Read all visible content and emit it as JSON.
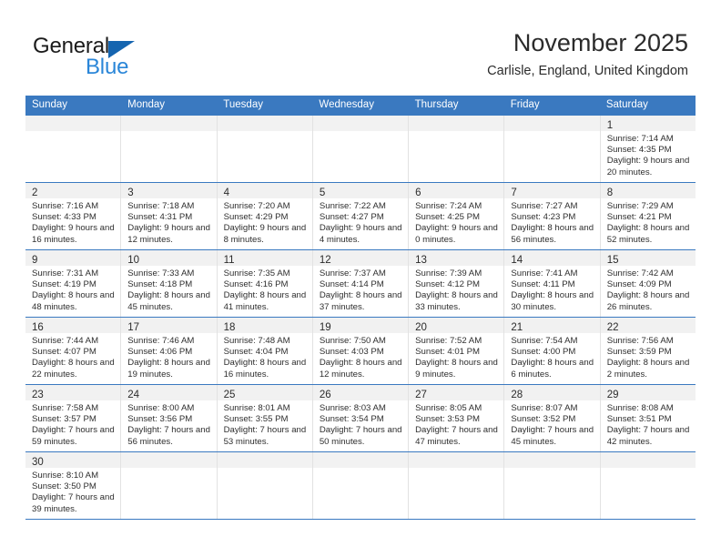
{
  "brand": {
    "line1": "General",
    "line2": "Blue",
    "triangle_icon": "brand-triangle-icon",
    "color_dark": "#1b1b1b",
    "color_blue": "#2a86d8"
  },
  "header": {
    "title": "November 2025",
    "subtitle": "Carlisle, England, United Kingdom"
  },
  "theme": {
    "header_blue": "#3a79c0",
    "daynum_band": "#f1f1f1",
    "grid_line": "#e2e2e2",
    "text": "#2b2b2b"
  },
  "weekdays": [
    "Sunday",
    "Monday",
    "Tuesday",
    "Wednesday",
    "Thursday",
    "Friday",
    "Saturday"
  ],
  "weeks": [
    [
      {
        "day": ""
      },
      {
        "day": ""
      },
      {
        "day": ""
      },
      {
        "day": ""
      },
      {
        "day": ""
      },
      {
        "day": ""
      },
      {
        "day": "1",
        "sunrise": "Sunrise: 7:14 AM",
        "sunset": "Sunset: 4:35 PM",
        "daylight": "Daylight: 9 hours and 20 minutes."
      }
    ],
    [
      {
        "day": "2",
        "sunrise": "Sunrise: 7:16 AM",
        "sunset": "Sunset: 4:33 PM",
        "daylight": "Daylight: 9 hours and 16 minutes."
      },
      {
        "day": "3",
        "sunrise": "Sunrise: 7:18 AM",
        "sunset": "Sunset: 4:31 PM",
        "daylight": "Daylight: 9 hours and 12 minutes."
      },
      {
        "day": "4",
        "sunrise": "Sunrise: 7:20 AM",
        "sunset": "Sunset: 4:29 PM",
        "daylight": "Daylight: 9 hours and 8 minutes."
      },
      {
        "day": "5",
        "sunrise": "Sunrise: 7:22 AM",
        "sunset": "Sunset: 4:27 PM",
        "daylight": "Daylight: 9 hours and 4 minutes."
      },
      {
        "day": "6",
        "sunrise": "Sunrise: 7:24 AM",
        "sunset": "Sunset: 4:25 PM",
        "daylight": "Daylight: 9 hours and 0 minutes."
      },
      {
        "day": "7",
        "sunrise": "Sunrise: 7:27 AM",
        "sunset": "Sunset: 4:23 PM",
        "daylight": "Daylight: 8 hours and 56 minutes."
      },
      {
        "day": "8",
        "sunrise": "Sunrise: 7:29 AM",
        "sunset": "Sunset: 4:21 PM",
        "daylight": "Daylight: 8 hours and 52 minutes."
      }
    ],
    [
      {
        "day": "9",
        "sunrise": "Sunrise: 7:31 AM",
        "sunset": "Sunset: 4:19 PM",
        "daylight": "Daylight: 8 hours and 48 minutes."
      },
      {
        "day": "10",
        "sunrise": "Sunrise: 7:33 AM",
        "sunset": "Sunset: 4:18 PM",
        "daylight": "Daylight: 8 hours and 45 minutes."
      },
      {
        "day": "11",
        "sunrise": "Sunrise: 7:35 AM",
        "sunset": "Sunset: 4:16 PM",
        "daylight": "Daylight: 8 hours and 41 minutes."
      },
      {
        "day": "12",
        "sunrise": "Sunrise: 7:37 AM",
        "sunset": "Sunset: 4:14 PM",
        "daylight": "Daylight: 8 hours and 37 minutes."
      },
      {
        "day": "13",
        "sunrise": "Sunrise: 7:39 AM",
        "sunset": "Sunset: 4:12 PM",
        "daylight": "Daylight: 8 hours and 33 minutes."
      },
      {
        "day": "14",
        "sunrise": "Sunrise: 7:41 AM",
        "sunset": "Sunset: 4:11 PM",
        "daylight": "Daylight: 8 hours and 30 minutes."
      },
      {
        "day": "15",
        "sunrise": "Sunrise: 7:42 AM",
        "sunset": "Sunset: 4:09 PM",
        "daylight": "Daylight: 8 hours and 26 minutes."
      }
    ],
    [
      {
        "day": "16",
        "sunrise": "Sunrise: 7:44 AM",
        "sunset": "Sunset: 4:07 PM",
        "daylight": "Daylight: 8 hours and 22 minutes."
      },
      {
        "day": "17",
        "sunrise": "Sunrise: 7:46 AM",
        "sunset": "Sunset: 4:06 PM",
        "daylight": "Daylight: 8 hours and 19 minutes."
      },
      {
        "day": "18",
        "sunrise": "Sunrise: 7:48 AM",
        "sunset": "Sunset: 4:04 PM",
        "daylight": "Daylight: 8 hours and 16 minutes."
      },
      {
        "day": "19",
        "sunrise": "Sunrise: 7:50 AM",
        "sunset": "Sunset: 4:03 PM",
        "daylight": "Daylight: 8 hours and 12 minutes."
      },
      {
        "day": "20",
        "sunrise": "Sunrise: 7:52 AM",
        "sunset": "Sunset: 4:01 PM",
        "daylight": "Daylight: 8 hours and 9 minutes."
      },
      {
        "day": "21",
        "sunrise": "Sunrise: 7:54 AM",
        "sunset": "Sunset: 4:00 PM",
        "daylight": "Daylight: 8 hours and 6 minutes."
      },
      {
        "day": "22",
        "sunrise": "Sunrise: 7:56 AM",
        "sunset": "Sunset: 3:59 PM",
        "daylight": "Daylight: 8 hours and 2 minutes."
      }
    ],
    [
      {
        "day": "23",
        "sunrise": "Sunrise: 7:58 AM",
        "sunset": "Sunset: 3:57 PM",
        "daylight": "Daylight: 7 hours and 59 minutes."
      },
      {
        "day": "24",
        "sunrise": "Sunrise: 8:00 AM",
        "sunset": "Sunset: 3:56 PM",
        "daylight": "Daylight: 7 hours and 56 minutes."
      },
      {
        "day": "25",
        "sunrise": "Sunrise: 8:01 AM",
        "sunset": "Sunset: 3:55 PM",
        "daylight": "Daylight: 7 hours and 53 minutes."
      },
      {
        "day": "26",
        "sunrise": "Sunrise: 8:03 AM",
        "sunset": "Sunset: 3:54 PM",
        "daylight": "Daylight: 7 hours and 50 minutes."
      },
      {
        "day": "27",
        "sunrise": "Sunrise: 8:05 AM",
        "sunset": "Sunset: 3:53 PM",
        "daylight": "Daylight: 7 hours and 47 minutes."
      },
      {
        "day": "28",
        "sunrise": "Sunrise: 8:07 AM",
        "sunset": "Sunset: 3:52 PM",
        "daylight": "Daylight: 7 hours and 45 minutes."
      },
      {
        "day": "29",
        "sunrise": "Sunrise: 8:08 AM",
        "sunset": "Sunset: 3:51 PM",
        "daylight": "Daylight: 7 hours and 42 minutes."
      }
    ],
    [
      {
        "day": "30",
        "sunrise": "Sunrise: 8:10 AM",
        "sunset": "Sunset: 3:50 PM",
        "daylight": "Daylight: 7 hours and 39 minutes."
      },
      {
        "day": ""
      },
      {
        "day": ""
      },
      {
        "day": ""
      },
      {
        "day": ""
      },
      {
        "day": ""
      },
      {
        "day": ""
      }
    ]
  ]
}
